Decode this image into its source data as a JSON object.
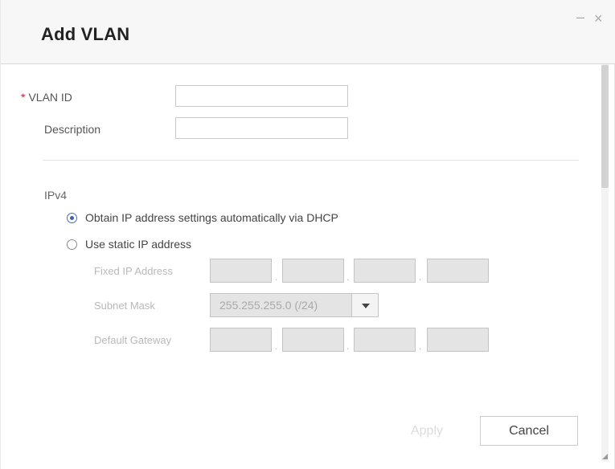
{
  "dialog": {
    "title": "Add VLAN",
    "minimize_glyph": "–",
    "close_glyph": "×"
  },
  "form": {
    "vlan_id": {
      "required_marker": "*",
      "label": "VLAN ID",
      "value": ""
    },
    "description": {
      "label": "Description",
      "value": ""
    }
  },
  "ipv4": {
    "section_label": "IPv4",
    "options": [
      {
        "label": "Obtain IP address settings automatically via DHCP",
        "selected": true
      },
      {
        "label": "Use static IP address",
        "selected": false
      }
    ],
    "fixed_ip": {
      "label": "Fixed IP Address",
      "octets": [
        "",
        "",
        "",
        ""
      ],
      "separator": "."
    },
    "subnet_mask": {
      "label": "Subnet Mask",
      "selected": "255.255.255.0 (/24)"
    },
    "default_gateway": {
      "label": "Default Gateway",
      "octets": [
        "",
        "",
        "",
        ""
      ],
      "separator": "."
    }
  },
  "footer": {
    "apply_label": "Apply",
    "cancel_label": "Cancel"
  },
  "colors": {
    "required": "#d0182f",
    "radio_selected": "#3f63aa",
    "disabled_text": "#b9b9b9",
    "disabled_fill": "#e4e4e4"
  }
}
